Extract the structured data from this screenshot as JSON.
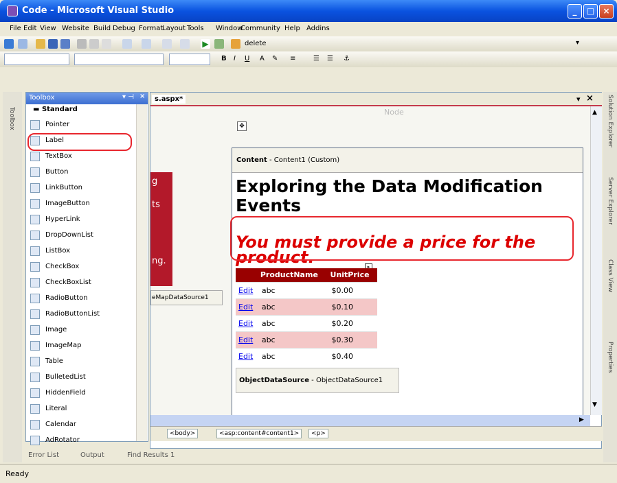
{
  "window": {
    "title": "Code - Microsoft Visual Studio"
  },
  "menu": [
    "File",
    "Edit",
    "View",
    "Website",
    "Build",
    "Debug",
    "Format",
    "Layout",
    "Tools",
    "Window",
    "Community",
    "Help",
    "Addins"
  ],
  "toolbar": {
    "find_value": "delete"
  },
  "left_rail": {
    "label": "Toolbox"
  },
  "toolbox": {
    "title": "Toolbox",
    "section": "Standard",
    "items": [
      "Pointer",
      "Label",
      "TextBox",
      "Button",
      "LinkButton",
      "ImageButton",
      "HyperLink",
      "DropDownList",
      "ListBox",
      "CheckBox",
      "CheckBoxList",
      "RadioButton",
      "RadioButtonList",
      "Image",
      "ImageMap",
      "Table",
      "BulletedList",
      "HiddenField",
      "Literal",
      "Calendar",
      "AdRotator"
    ],
    "selected": "Label"
  },
  "editor": {
    "tab": "s.aspx*",
    "node_label": "Node",
    "sidebar_texts": [
      "g",
      "ts",
      "ng."
    ],
    "sitemap_source": "eMapDataSource1",
    "content": {
      "header_bold": "Content",
      "header_rest": " - Content1 (Custom)",
      "heading": "Exploring the Data Modification Events",
      "warning": "You must provide a price for the product."
    },
    "grid": {
      "columns": [
        "",
        "ProductName",
        "UnitPrice"
      ],
      "edit_label": "Edit",
      "rows": [
        {
          "name": "abc",
          "price": "$0.00"
        },
        {
          "name": "abc",
          "price": "$0.10"
        },
        {
          "name": "abc",
          "price": "$0.20"
        },
        {
          "name": "abc",
          "price": "$0.30"
        },
        {
          "name": "abc",
          "price": "$0.40"
        }
      ]
    },
    "datasource": {
      "bold": "ObjectDataSource",
      "rest": " - ObjectDataSource1"
    },
    "tags": [
      "<body>",
      "<asp:content#content1>",
      "<p>"
    ]
  },
  "right_rail": [
    "Solution Explorer",
    "Server Explorer",
    "Class View",
    "Properties"
  ],
  "bottom_tabs": [
    "Error List",
    "Output",
    "Find Results 1"
  ],
  "status": "Ready",
  "colors": {
    "accent": "#0a53e0",
    "warning": "#dc0000",
    "grid_header": "#990000",
    "highlight": "#e8262d"
  }
}
